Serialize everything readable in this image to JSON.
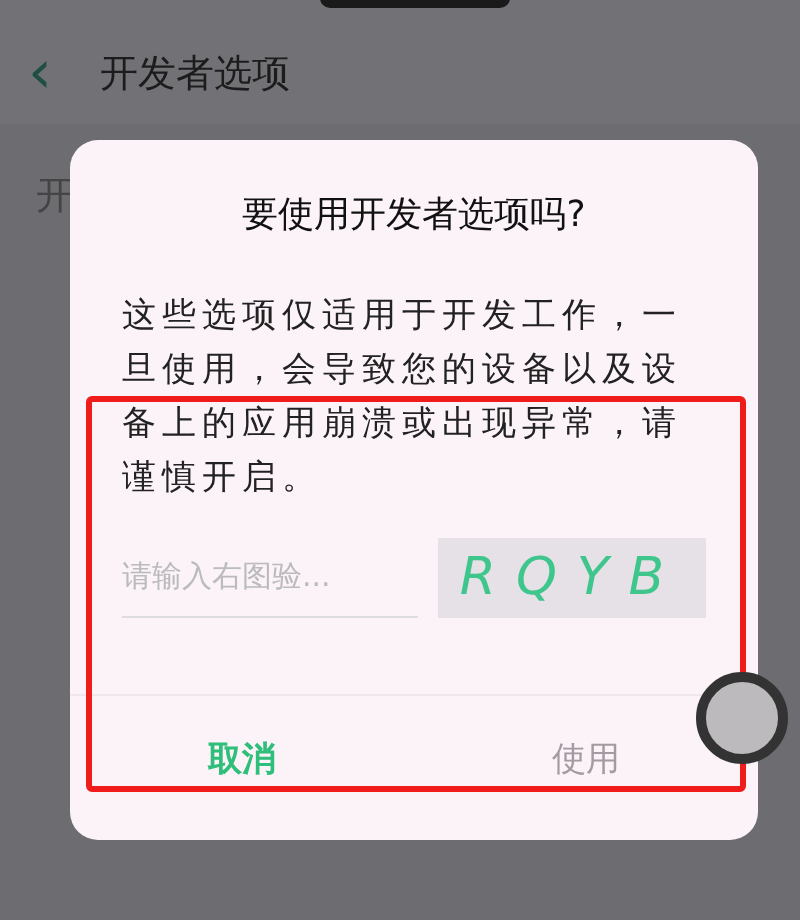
{
  "header": {
    "back": "‹",
    "title": "开发者选项"
  },
  "background_row": {
    "label": "开"
  },
  "dialog": {
    "title": "要使用开发者选项吗?",
    "message": "这些选项仅适用于开发工作，一旦使用，会导致您的设备以及设备上的应用崩溃或出现异常，请谨慎开启。",
    "captcha_field": {
      "placeholder": "请输入右图验..."
    },
    "captcha_image": {
      "text": "RQYB"
    },
    "buttons": [
      {
        "label": "取消",
        "disabled": false
      },
      {
        "label": "使用",
        "disabled": true
      }
    ]
  }
}
